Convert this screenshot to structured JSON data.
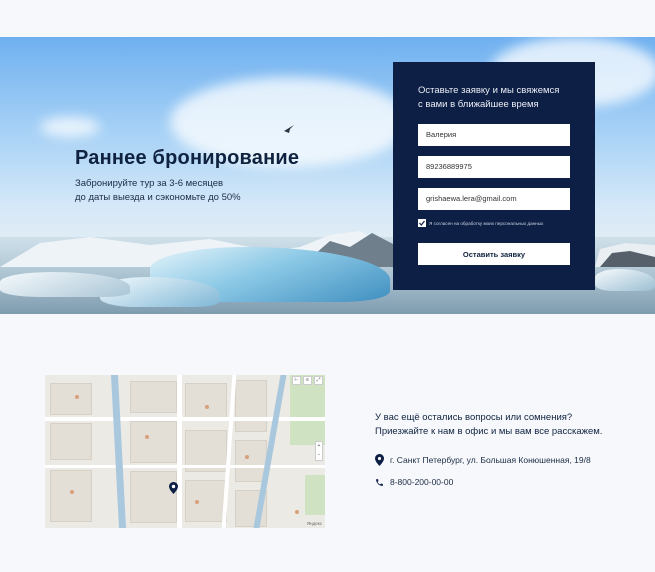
{
  "hero": {
    "title": "Раннее бронирование",
    "subtitle_line1": "Забронируйте тур за 3-6 месяцев",
    "subtitle_line2": "до даты выезда и сэкономьте до 50%"
  },
  "form": {
    "heading_line1": "Оставьте заявку и мы свяжемся",
    "heading_line2": "с вами в ближайшее время",
    "name_value": "Валерия",
    "phone_value": "89236889975",
    "email_value": "grishaewa.lera@gmail.com",
    "consent_label": "Я согласен на обработку моих персональных данных",
    "consent_checked": true,
    "submit_label": "Оставить заявку"
  },
  "map": {
    "logo_text": "Яндекс"
  },
  "contact": {
    "question_line1": "У вас ещё остались вопросы или сомнения?",
    "question_line2": "Приезжайте к нам в офис и мы вам все расскажем.",
    "address": "г. Санкт Петербург, ул. Большая Конюшенная, 19/8",
    "phone": "8-800-200-00-00"
  },
  "colors": {
    "navy": "#0e1f45",
    "text_dark": "#0f2340",
    "page_bg": "#f7f8fb"
  },
  "icons": {
    "address": "location-pin-icon",
    "phone": "phone-icon",
    "map_marker": "map-marker-icon",
    "consent": "checkmark-icon"
  }
}
